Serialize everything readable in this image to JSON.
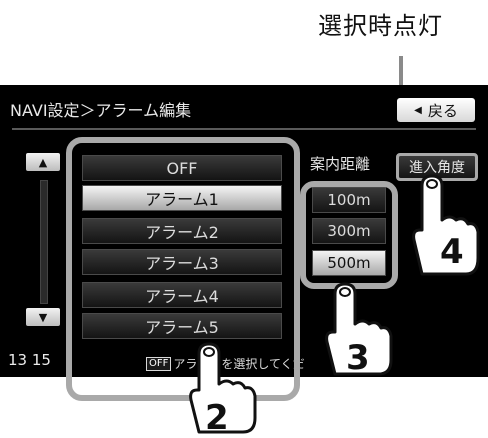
{
  "callout": {
    "caption": "選択時点灯"
  },
  "header": {
    "title": "NAVI設定＞アラーム編集",
    "back_label": "戻る"
  },
  "alarm_list": {
    "items": [
      "OFF",
      "アラーム1",
      "アラーム2",
      "アラーム3",
      "アラーム4",
      "アラーム5"
    ],
    "selected_index": 1
  },
  "distance": {
    "header": "案内距離",
    "items": [
      "100m",
      "300m",
      "500m"
    ],
    "selected_index": 2
  },
  "angle_button": {
    "label": "進入角度"
  },
  "status": {
    "clock": "13 15",
    "off_chip": "OFF",
    "message": "アラー　を選択してくだ"
  },
  "steps": [
    "2",
    "3",
    "4"
  ],
  "icons": {
    "back": "triangle-left-icon",
    "scroll_up": "scroll-up-icon",
    "scroll_down": "scroll-down-icon",
    "pointer": "pointing-hand-icon"
  }
}
